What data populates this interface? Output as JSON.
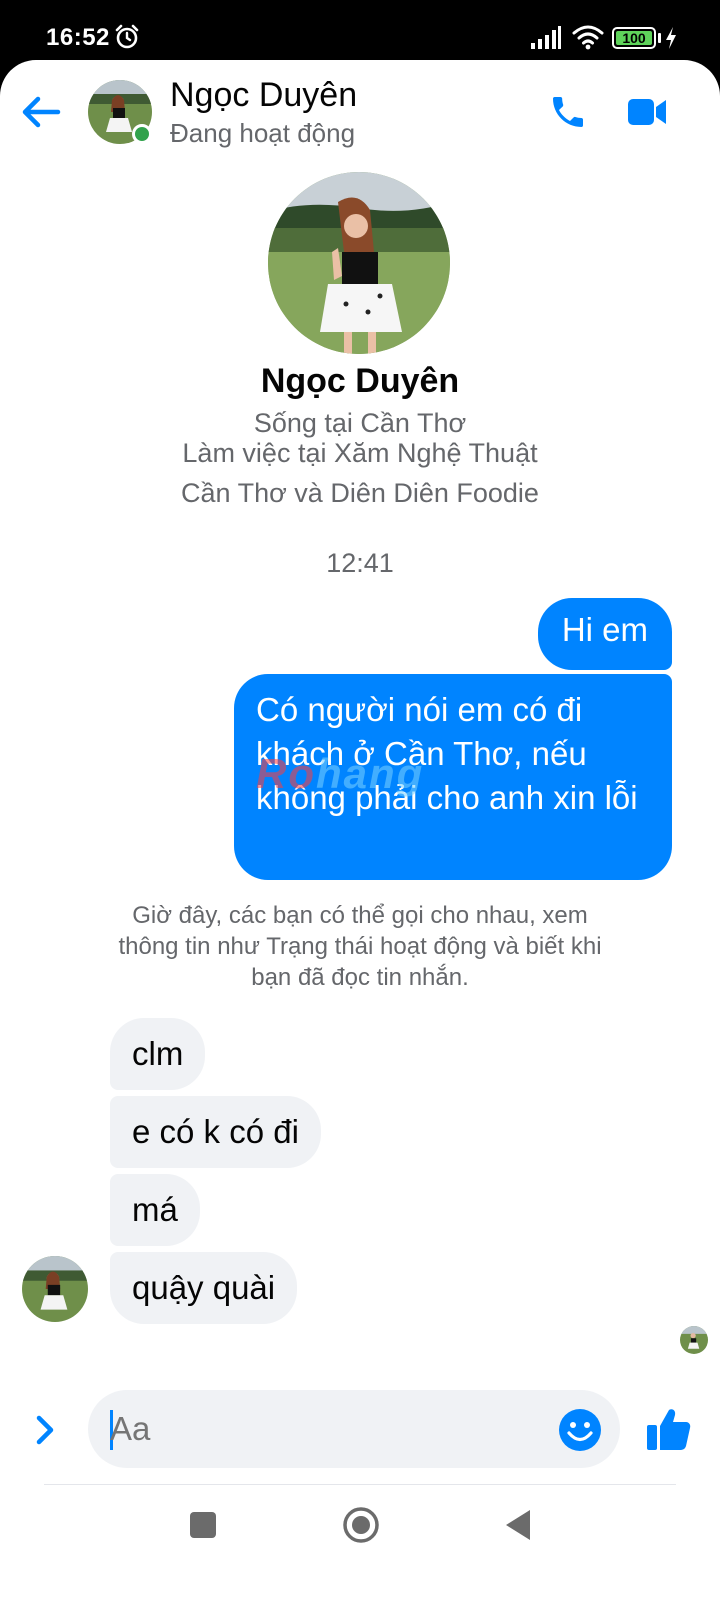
{
  "status_bar": {
    "time": "16:52",
    "battery": "100",
    "icons": [
      "alarm-icon",
      "signal-icon",
      "wifi-icon",
      "battery-icon",
      "charging-icon"
    ]
  },
  "header": {
    "name": "Ngọc Duyên",
    "status": "Đang hoạt động",
    "icons": [
      "back-arrow-icon",
      "phone-icon",
      "video-icon"
    ]
  },
  "profile": {
    "name": "Ngọc Duyên",
    "lines": [
      "Sống tại Cần Thơ",
      "Làm việc tại Xăm Nghệ Thuật",
      "Cần Thơ và Diên Diên Foodie"
    ]
  },
  "conversation": {
    "timestamp": "12:41",
    "sent": [
      "Hi em",
      "Có người nói em có đi khách ở Cần Thơ, nếu không phải cho anh xin lỗi"
    ],
    "system_note": "Giờ đây, các bạn có thể gọi cho nhau, xem thông tin như Trạng thái hoạt động và biết khi bạn đã đọc tin nhắn.",
    "received": [
      "clm",
      "e có k có đi",
      "má",
      "quậy quài"
    ]
  },
  "watermark": {
    "part1": "Ro",
    "part2": "hang"
  },
  "composer": {
    "placeholder": "Aa"
  },
  "colors": {
    "accent": "#0084ff",
    "received_bubble": "#f0f2f5",
    "online": "#31a24c",
    "secondary_text": "#65676b"
  }
}
